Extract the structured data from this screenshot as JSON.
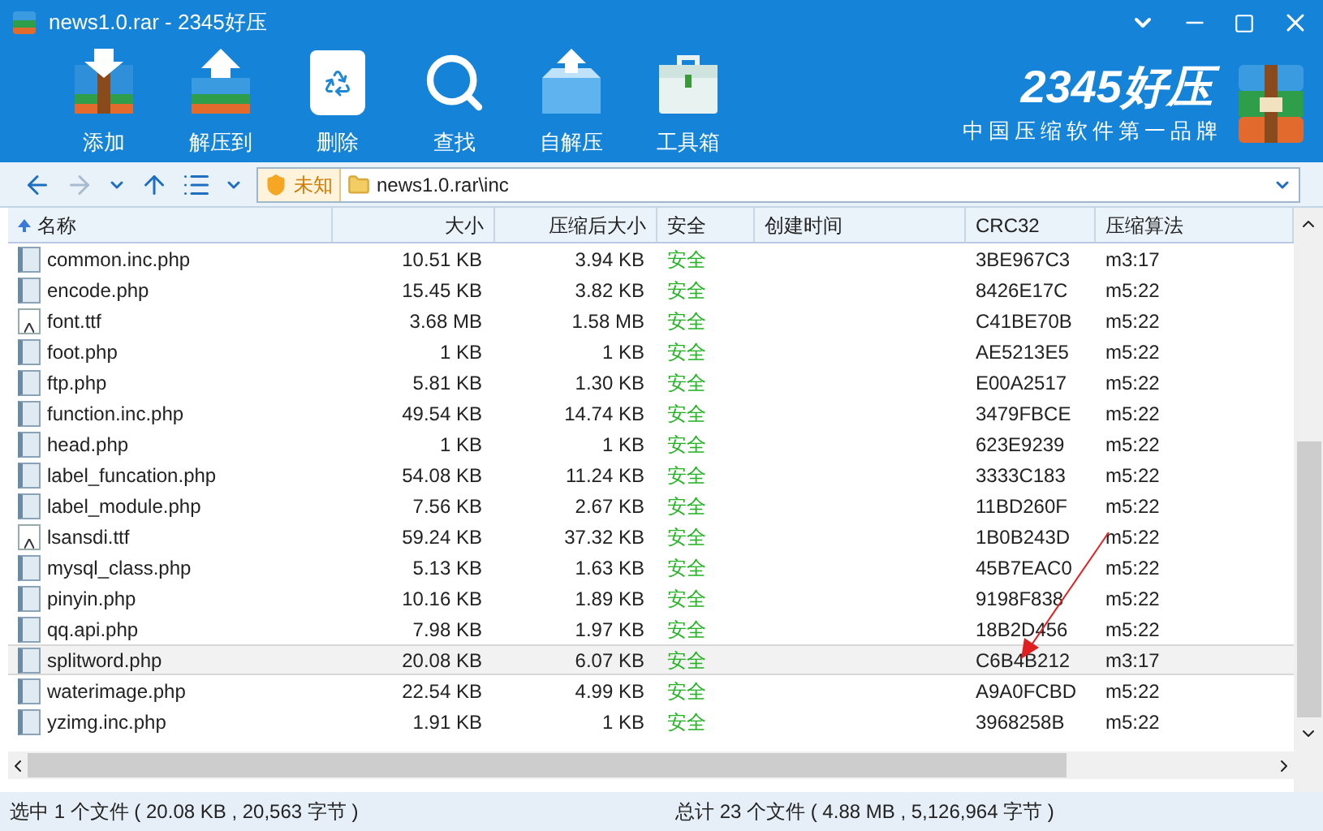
{
  "window": {
    "title": "news1.0.rar - 2345好压"
  },
  "toolbar": [
    {
      "label": "添加",
      "kind": "add"
    },
    {
      "label": "解压到",
      "kind": "extract"
    },
    {
      "label": "删除",
      "kind": "delete"
    },
    {
      "label": "查找",
      "kind": "find"
    },
    {
      "label": "自解压",
      "kind": "sfx"
    },
    {
      "label": "工具箱",
      "kind": "tools"
    }
  ],
  "brand": {
    "name": "2345好压",
    "slogan": "中国压缩软件第一品牌"
  },
  "address": {
    "security": "未知",
    "path": "news1.0.rar\\inc"
  },
  "table": {
    "columns": [
      "名称",
      "大小",
      "压缩后大小",
      "安全",
      "创建时间",
      "CRC32",
      "压缩算法"
    ],
    "rows": [
      {
        "name": "common.inc.php",
        "kind": "text",
        "size": "10.51 KB",
        "packed": "3.94 KB",
        "safe": "安全",
        "crc": "3BE967C3",
        "method": "m3:17",
        "selected": false
      },
      {
        "name": "encode.php",
        "kind": "text",
        "size": "15.45 KB",
        "packed": "3.82 KB",
        "safe": "安全",
        "crc": "8426E17C",
        "method": "m5:22",
        "selected": false
      },
      {
        "name": "font.ttf",
        "kind": "font",
        "size": "3.68 MB",
        "packed": "1.58 MB",
        "safe": "安全",
        "crc": "C41BE70B",
        "method": "m5:22",
        "selected": false
      },
      {
        "name": "foot.php",
        "kind": "text",
        "size": "1 KB",
        "packed": "1 KB",
        "safe": "安全",
        "crc": "AE5213E5",
        "method": "m5:22",
        "selected": false
      },
      {
        "name": "ftp.php",
        "kind": "text",
        "size": "5.81 KB",
        "packed": "1.30 KB",
        "safe": "安全",
        "crc": "E00A2517",
        "method": "m5:22",
        "selected": false
      },
      {
        "name": "function.inc.php",
        "kind": "text",
        "size": "49.54 KB",
        "packed": "14.74 KB",
        "safe": "安全",
        "crc": "3479FBCE",
        "method": "m5:22",
        "selected": false
      },
      {
        "name": "head.php",
        "kind": "text",
        "size": "1 KB",
        "packed": "1 KB",
        "safe": "安全",
        "crc": "623E9239",
        "method": "m5:22",
        "selected": false
      },
      {
        "name": "label_funcation.php",
        "kind": "text",
        "size": "54.08 KB",
        "packed": "11.24 KB",
        "safe": "安全",
        "crc": "3333C183",
        "method": "m5:22",
        "selected": false
      },
      {
        "name": "label_module.php",
        "kind": "text",
        "size": "7.56 KB",
        "packed": "2.67 KB",
        "safe": "安全",
        "crc": "11BD260F",
        "method": "m5:22",
        "selected": false
      },
      {
        "name": "lsansdi.ttf",
        "kind": "font",
        "size": "59.24 KB",
        "packed": "37.32 KB",
        "safe": "安全",
        "crc": "1B0B243D",
        "method": "m5:22",
        "selected": false
      },
      {
        "name": "mysql_class.php",
        "kind": "text",
        "size": "5.13 KB",
        "packed": "1.63 KB",
        "safe": "安全",
        "crc": "45B7EAC0",
        "method": "m5:22",
        "selected": false
      },
      {
        "name": "pinyin.php",
        "kind": "text",
        "size": "10.16 KB",
        "packed": "1.89 KB",
        "safe": "安全",
        "crc": "9198F838",
        "method": "m5:22",
        "selected": false
      },
      {
        "name": "qq.api.php",
        "kind": "text",
        "size": "7.98 KB",
        "packed": "1.97 KB",
        "safe": "安全",
        "crc": "18B2D456",
        "method": "m5:22",
        "selected": false
      },
      {
        "name": "splitword.php",
        "kind": "text",
        "size": "20.08 KB",
        "packed": "6.07 KB",
        "safe": "安全",
        "crc": "C6B4B212",
        "method": "m3:17",
        "selected": true
      },
      {
        "name": "waterimage.php",
        "kind": "text",
        "size": "22.54 KB",
        "packed": "4.99 KB",
        "safe": "安全",
        "crc": "A9A0FCBD",
        "method": "m5:22",
        "selected": false
      },
      {
        "name": "yzimg.inc.php",
        "kind": "text",
        "size": "1.91 KB",
        "packed": "1 KB",
        "safe": "安全",
        "crc": "3968258B",
        "method": "m5:22",
        "selected": false
      }
    ]
  },
  "status_bar": {
    "left": "选中 1 个文件 ( 20.08 KB , 20,563 字节 )",
    "right": "总计 23 个文件 ( 4.88 MB , 5,126,964 字节 )"
  }
}
